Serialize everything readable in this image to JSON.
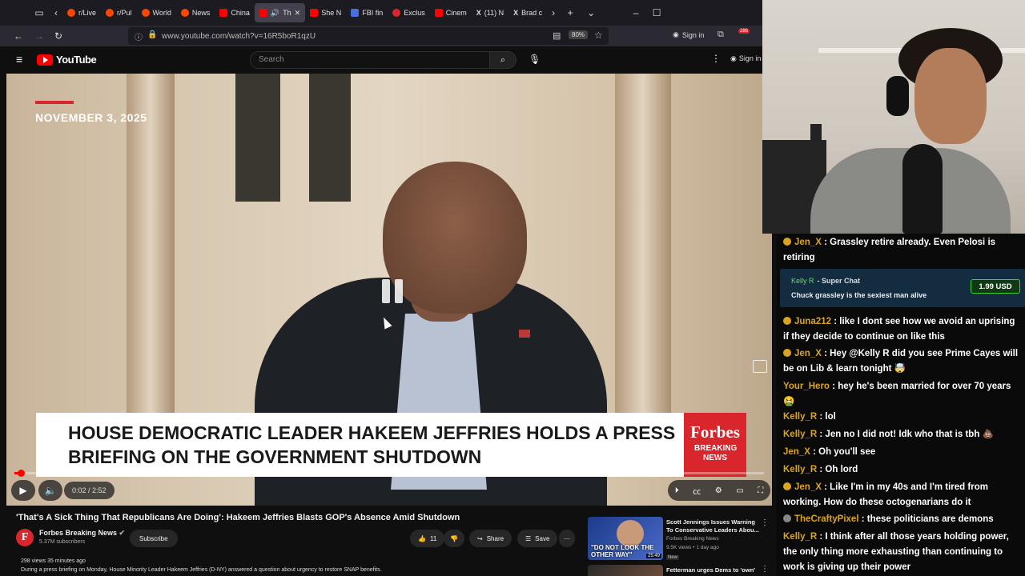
{
  "browser": {
    "tabs": [
      {
        "label": "r/Live",
        "color": "#ff4500"
      },
      {
        "label": "r/Pul",
        "color": "#ff4500"
      },
      {
        "label": "World",
        "color": "#ff4500"
      },
      {
        "label": "News",
        "color": "#ff4500"
      },
      {
        "label": "China",
        "color": "#ff0000"
      },
      {
        "label": "Th",
        "color": "#ff0000"
      },
      {
        "label": "She N",
        "color": "#ff0000"
      },
      {
        "label": "FBI fin",
        "color": "#4a6ee0"
      },
      {
        "label": "Exclus",
        "color": "#d8262c"
      },
      {
        "label": "Cinem",
        "color": "#ff0000"
      },
      {
        "label": "(11) N",
        "color": "#000000"
      },
      {
        "label": "Brad c",
        "color": "#000000"
      }
    ],
    "url": "www.youtube.com/watch?v=16R5boR1qzU",
    "zoom": "80%",
    "sign_in": "Sign in",
    "notif_count": "286"
  },
  "youtube": {
    "logo": "YouTube",
    "search_placeholder": "Search",
    "sign_in": "Sign in"
  },
  "video": {
    "date": "NOVEMBER 3, 2025",
    "lower_third": "HOUSE DEMOCRATIC LEADER HAKEEM JEFFRIES HOLDS A PRESS BRIEFING ON THE GOVERNMENT SHUTDOWN",
    "brand": "Forbes",
    "brand_sub": "BREAKING NEWS",
    "time": "0:02 / 2:52",
    "progress": 0.012
  },
  "details": {
    "title": "'That's A Sick Thing That Republicans Are Doing': Hakeem Jeffries Blasts GOP's Absence Amid Shutdown",
    "channel": "Forbes Breaking News",
    "channel_initial": "F",
    "subscribers": "5.37M subscribers",
    "subscribe": "Subscribe",
    "likes": "11",
    "share": "Share",
    "save": "Save",
    "views_time": "298 views  35 minutes ago",
    "description": "During a press briefing on Monday, House Minority Leader Hakeem Jeffries (D-NY) answered a question about urgency to restore SNAP benefits."
  },
  "recommendations": [
    {
      "title": "Scott Jennings Issues Warning To Conservative Leaders Abou...",
      "channel": "Forbes Breaking News",
      "meta": "9.5K views • 1 day ago",
      "badge": "New",
      "thumb_text": "\"DO NOT LOOK THE OTHER WAY\"",
      "duration": "25:49"
    },
    {
      "title": "Fetterman urges Dems to 'own'"
    }
  ],
  "chat": {
    "messages": [
      {
        "user": "Jen_X",
        "text": "Grassley retire already. Even Pelosi is retiring",
        "color": "#d9a520",
        "badge": true
      },
      {
        "user": "Juna212",
        "text": "like I dont see how we avoid an uprising if they decide to continue on like this",
        "color": "#d9a520",
        "badge": true
      },
      {
        "user": "Jen_X",
        "text": "Hey @Kelly R did you see Prime Cayes will be on Lib & learn tonight 🤯",
        "color": "#d9a520",
        "badge": true
      },
      {
        "user": "Your_Hero",
        "text": "hey he's been married for over 70 years 🤮",
        "color": "#d9a520",
        "badge": false
      },
      {
        "user": "Kelly_R",
        "text": "lol",
        "color": "#d9a520",
        "badge": false
      },
      {
        "user": "Kelly_R",
        "text": "Jen no I did not! Idk who that is tbh 💩",
        "color": "#d9a520",
        "badge": false
      },
      {
        "user": "Jen_X",
        "text": "Oh you'll see",
        "color": "#d9a520",
        "badge": false
      },
      {
        "user": "Kelly_R",
        "text": "Oh lord",
        "color": "#d9a520",
        "badge": false
      },
      {
        "user": "Jen_X",
        "text": "Like I'm in my 40s and I'm tired from working. How do these octogenarians do it",
        "color": "#d9a520",
        "badge": true
      },
      {
        "user": "TheCraftyPixel",
        "text": "these politicians are demons",
        "color": "#d9a520",
        "badge": false
      },
      {
        "user": "Kelly_R",
        "text": "I think after all those years holding power, the only thing more exhausting than continuing to work is giving up their power",
        "color": "#d9a520",
        "badge": false
      }
    ],
    "superchat": {
      "user": "Kelly R",
      "label": "- Super Chat",
      "text": "Chuck grassley is the sexiest man alive",
      "amount": "1.99 USD"
    }
  }
}
